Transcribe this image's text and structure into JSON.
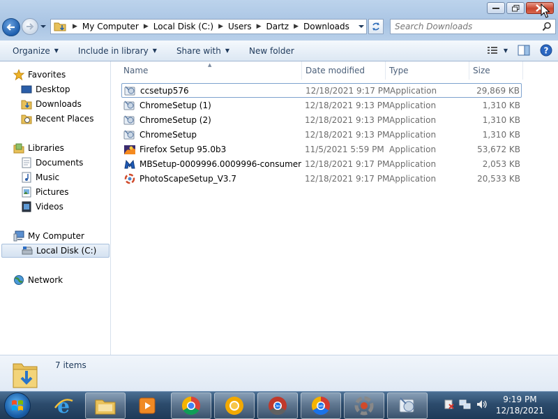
{
  "address": {
    "crumbs": [
      "My Computer",
      "Local Disk (C:)",
      "Users",
      "Dartz",
      "Downloads"
    ]
  },
  "search": {
    "placeholder": "Search Downloads"
  },
  "toolbar": {
    "organize": "Organize",
    "include_in_library": "Include in library",
    "share_with": "Share with",
    "new_folder": "New folder"
  },
  "nav": {
    "favorites": "Favorites",
    "desktop": "Desktop",
    "downloads": "Downloads",
    "recent_places": "Recent Places",
    "libraries": "Libraries",
    "documents": "Documents",
    "music": "Music",
    "pictures": "Pictures",
    "videos": "Videos",
    "my_computer": "My Computer",
    "local_disk": "Local Disk (C:)",
    "network": "Network"
  },
  "columns": {
    "name": "Name",
    "date": "Date modified",
    "type": "Type",
    "size": "Size"
  },
  "files": [
    {
      "name": "ccsetup576",
      "date": "12/18/2021 9:17 PM",
      "type": "Application",
      "size": "29,869 KB",
      "icon": "installer-icon"
    },
    {
      "name": "ChromeSetup (1)",
      "date": "12/18/2021 9:13 PM",
      "type": "Application",
      "size": "1,310 KB",
      "icon": "installer-icon"
    },
    {
      "name": "ChromeSetup (2)",
      "date": "12/18/2021 9:13 PM",
      "type": "Application",
      "size": "1,310 KB",
      "icon": "installer-icon"
    },
    {
      "name": "ChromeSetup",
      "date": "12/18/2021 9:13 PM",
      "type": "Application",
      "size": "1,310 KB",
      "icon": "installer-icon"
    },
    {
      "name": "Firefox Setup 95.0b3",
      "date": "11/5/2021 5:59 PM",
      "type": "Application",
      "size": "53,672 KB",
      "icon": "firefox-installer-icon"
    },
    {
      "name": "MBSetup-0009996.0009996-consumer",
      "date": "12/18/2021 9:17 PM",
      "type": "Application",
      "size": "2,053 KB",
      "icon": "malwarebytes-installer-icon"
    },
    {
      "name": "PhotoScapeSetup_V3.7",
      "date": "12/18/2021 9:17 PM",
      "type": "Application",
      "size": "20,533 KB",
      "icon": "photoscape-installer-icon"
    }
  ],
  "details": {
    "count": "7 items"
  },
  "clock": {
    "time": "9:19 PM",
    "date": "12/18/2021"
  },
  "taskbar_labels": {
    "dev": "Dev",
    "beta": "Beta"
  },
  "colors": {
    "accent": "#1e395b",
    "selection_border": "#7da2ce",
    "close_red": "#c8462f"
  }
}
